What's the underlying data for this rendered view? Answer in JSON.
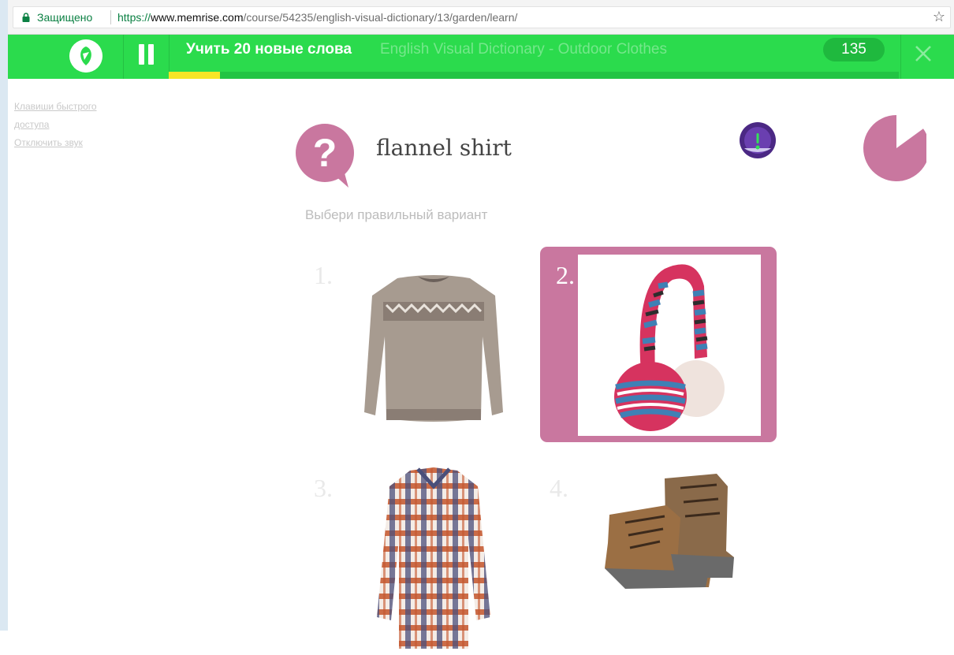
{
  "browser": {
    "secure_label": "Защищено",
    "url_scheme": "https://",
    "url_host": "www.memrise.com",
    "url_path": "/course/54235/english-visual-dictionary/13/garden/learn/"
  },
  "header": {
    "session_title": "Учить 20 новые слова",
    "course_title": "English Visual Dictionary - Outdoor Clothes",
    "points": "135",
    "progress_fraction": 0.07,
    "accent_color": "#2bdb4d",
    "progress_color": "#f7e526"
  },
  "sidebar": {
    "links": [
      "Клавиши быстрого доступа",
      "Отключить звук"
    ]
  },
  "prompt": {
    "word": "flannel shirt",
    "instruction": "Выбери правильный вариант",
    "bubble_color": "#c9779f",
    "timer_fraction_remaining": 0.85
  },
  "choices": [
    {
      "number": "1.",
      "image": "sweater",
      "selected": false
    },
    {
      "number": "2.",
      "image": "earmuffs",
      "selected": true
    },
    {
      "number": "3.",
      "image": "flannel-shirt",
      "selected": false
    },
    {
      "number": "4.",
      "image": "hiking-boots",
      "selected": false
    }
  ]
}
